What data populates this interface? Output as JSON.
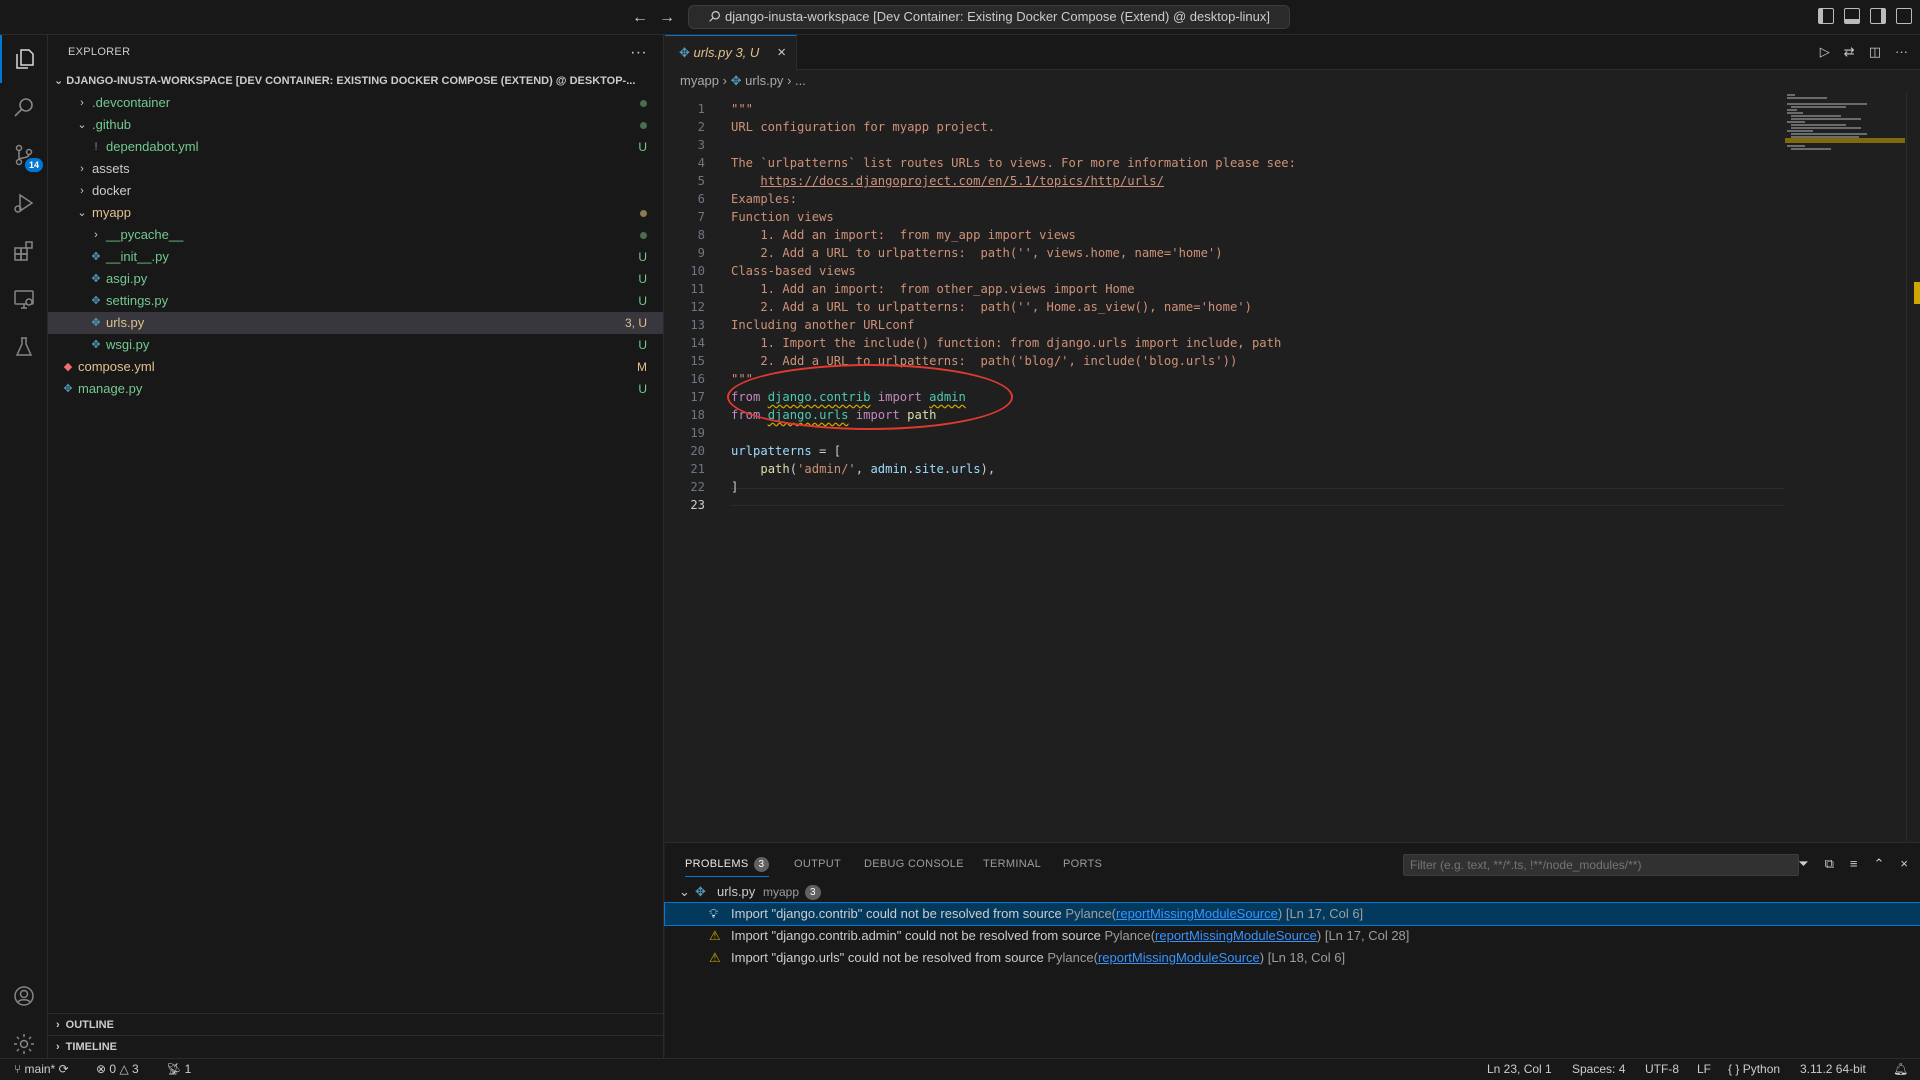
{
  "titlebar": {
    "back": "←",
    "forward": "→",
    "command_center": "django-inusta-workspace [Dev Container: Existing Docker Compose (Extend) @ desktop-linux]"
  },
  "activitybar": {
    "scm_badge": "14"
  },
  "sidebar": {
    "title": "EXPLORER",
    "root": "DJANGO-INUSTA-WORKSPACE [DEV CONTAINER: EXISTING DOCKER COMPOSE (EXTEND) @ DESKTOP-...",
    "tree": [
      {
        "name": ".devcontainer",
        "type": "folder",
        "open": false,
        "depth": 1,
        "status": "",
        "dot": true,
        "color": "untracked"
      },
      {
        "name": ".github",
        "type": "folder",
        "open": true,
        "depth": 1,
        "status": "",
        "dot": true,
        "color": "untracked"
      },
      {
        "name": "dependabot.yml",
        "type": "yml",
        "depth": 2,
        "status": "U",
        "dot": false,
        "color": "untracked"
      },
      {
        "name": "assets",
        "type": "folder",
        "open": false,
        "depth": 1,
        "status": "",
        "dot": false,
        "color": "plain"
      },
      {
        "name": "docker",
        "type": "folder",
        "open": false,
        "depth": 1,
        "status": "",
        "dot": false,
        "color": "plain"
      },
      {
        "name": "myapp",
        "type": "folder",
        "open": true,
        "depth": 1,
        "status": "",
        "dot": true,
        "color": "modified"
      },
      {
        "name": "__pycache__",
        "type": "folder",
        "open": false,
        "depth": 2,
        "status": "",
        "dot": true,
        "color": "untracked"
      },
      {
        "name": "__init__.py",
        "type": "py",
        "depth": 2,
        "status": "U",
        "dot": false,
        "color": "untracked"
      },
      {
        "name": "asgi.py",
        "type": "py",
        "depth": 2,
        "status": "U",
        "dot": false,
        "color": "untracked"
      },
      {
        "name": "settings.py",
        "type": "py",
        "depth": 2,
        "status": "U",
        "dot": false,
        "color": "untracked"
      },
      {
        "name": "urls.py",
        "type": "py",
        "depth": 2,
        "status": "3, U",
        "dot": false,
        "color": "modified",
        "selected": true
      },
      {
        "name": "wsgi.py",
        "type": "py",
        "depth": 2,
        "status": "U",
        "dot": false,
        "color": "untracked"
      },
      {
        "name": "compose.yml",
        "type": "compose",
        "depth": 0,
        "status": "M",
        "dot": false,
        "color": "modified"
      },
      {
        "name": "manage.py",
        "type": "py",
        "depth": 0,
        "status": "U",
        "dot": false,
        "color": "untracked"
      }
    ],
    "outline": "OUTLINE",
    "timeline": "TIMELINE"
  },
  "editor": {
    "tab_label": "urls.py",
    "tab_status": "3, U",
    "breadcrumb": [
      "myapp",
      "urls.py",
      "..."
    ],
    "lines": [
      [
        {
          "t": "\"\"\"",
          "c": "str"
        }
      ],
      [
        {
          "t": "URL configuration for myapp project.",
          "c": "str"
        }
      ],
      [],
      [
        {
          "t": "The `urlpatterns` list routes URLs to views. For more information please see:",
          "c": "str"
        }
      ],
      [
        {
          "t": "    ",
          "c": "str"
        },
        {
          "t": "https://docs.djangoproject.com/en/5.1/topics/http/urls/",
          "c": "link"
        }
      ],
      [
        {
          "t": "Examples:",
          "c": "str"
        }
      ],
      [
        {
          "t": "Function views",
          "c": "str"
        }
      ],
      [
        {
          "t": "    1. Add an import:  from my_app import views",
          "c": "str"
        }
      ],
      [
        {
          "t": "    2. Add a URL to urlpatterns:  path('', views.home, name='home')",
          "c": "str"
        }
      ],
      [
        {
          "t": "Class-based views",
          "c": "str"
        }
      ],
      [
        {
          "t": "    1. Add an import:  from other_app.views import Home",
          "c": "str"
        }
      ],
      [
        {
          "t": "    2. Add a URL to urlpatterns:  path('', Home.as_view(), name='home')",
          "c": "str"
        }
      ],
      [
        {
          "t": "Including another URLconf",
          "c": "str"
        }
      ],
      [
        {
          "t": "    1. Import the include() function: from django.urls import include, path",
          "c": "str"
        }
      ],
      [
        {
          "t": "    2. Add a URL to urlpatterns:  path('blog/', include('blog.urls'))",
          "c": "str"
        }
      ],
      [
        {
          "t": "\"\"\"",
          "c": "str"
        }
      ],
      [
        {
          "t": "from",
          "c": "kw"
        },
        {
          "t": " ",
          "c": ""
        },
        {
          "t": "django.contrib",
          "c": "mod"
        },
        {
          "t": " ",
          "c": ""
        },
        {
          "t": "import",
          "c": "kw"
        },
        {
          "t": " ",
          "c": ""
        },
        {
          "t": "admin",
          "c": "mod"
        }
      ],
      [
        {
          "t": "from",
          "c": "kw"
        },
        {
          "t": " ",
          "c": ""
        },
        {
          "t": "django.urls",
          "c": "mod"
        },
        {
          "t": " ",
          "c": ""
        },
        {
          "t": "import",
          "c": "kw"
        },
        {
          "t": " ",
          "c": ""
        },
        {
          "t": "path",
          "c": "fn"
        }
      ],
      [],
      [
        {
          "t": "urlpatterns",
          "c": "var"
        },
        {
          "t": " = [",
          "c": ""
        }
      ],
      [
        {
          "t": "    ",
          "c": ""
        },
        {
          "t": "path",
          "c": "fn"
        },
        {
          "t": "(",
          "c": ""
        },
        {
          "t": "'admin/'",
          "c": "str"
        },
        {
          "t": ", ",
          "c": ""
        },
        {
          "t": "admin",
          "c": "mod2"
        },
        {
          "t": ".",
          "c": ""
        },
        {
          "t": "site",
          "c": "var"
        },
        {
          "t": ".",
          "c": ""
        },
        {
          "t": "urls",
          "c": "var"
        },
        {
          "t": "),",
          "c": ""
        }
      ],
      [
        {
          "t": "]",
          "c": ""
        }
      ],
      []
    ],
    "current_line": 23
  },
  "panel": {
    "tabs": [
      "PROBLEMS",
      "OUTPUT",
      "DEBUG CONSOLE",
      "TERMINAL",
      "PORTS"
    ],
    "problems_count": "3",
    "filter_placeholder": "Filter (e.g. text, **/*.ts, !**/node_modules/**)",
    "group_file": "urls.py",
    "group_folder": "myapp",
    "group_count": "3",
    "problems": [
      {
        "msg": "Import \"django.contrib\" could not be resolved from source",
        "source": "Pylance",
        "code": "reportMissingModuleSource",
        "loc": "[Ln 17, Col 6]",
        "icon": "lightbulb"
      },
      {
        "msg": "Import \"django.contrib.admin\" could not be resolved from source",
        "source": "Pylance",
        "code": "reportMissingModuleSource",
        "loc": "[Ln 17, Col 28]",
        "icon": "warning"
      },
      {
        "msg": "Import \"django.urls\" could not be resolved from source",
        "source": "Pylance",
        "code": "reportMissingModuleSource",
        "loc": "[Ln 18, Col 6]",
        "icon": "warning"
      }
    ]
  },
  "statusbar": {
    "branch": "main*",
    "errors": "0",
    "warnings": "3",
    "ports": "1",
    "position": "Ln 23, Col 1",
    "spaces": "Spaces: 4",
    "encoding": "UTF-8",
    "eol": "LF",
    "language": "Python",
    "interpreter": "3.11.2 64-bit"
  },
  "colors": {
    "accent": "#0078d4",
    "untracked": "#73c991",
    "modified": "#e2c08d",
    "warning": "#cca700",
    "annotation": "#e03a2f"
  },
  "icons": [
    "explorer-icon",
    "search-icon",
    "source-control-icon",
    "run-debug-icon",
    "extensions-icon",
    "remote-explorer-icon",
    "testing-icon",
    "account-icon",
    "settings-gear-icon"
  ]
}
